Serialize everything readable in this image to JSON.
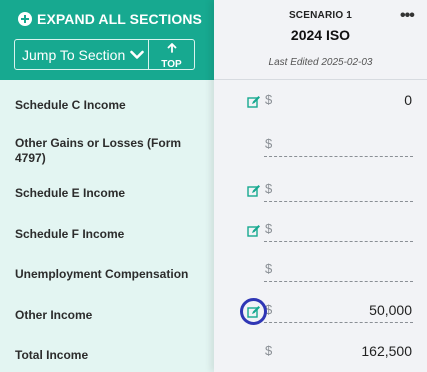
{
  "header": {
    "expand_all_label": "EXPAND ALL SECTIONS",
    "jump_to_label": "Jump To Section",
    "top_label": "TOP"
  },
  "scenario": {
    "label": "SCENARIO 1",
    "name": "2024 ISO",
    "last_edited": "Last Edited 2025-02-03",
    "more_label": "•••"
  },
  "currency_symbol": "$",
  "rows": [
    {
      "label": "Schedule C Income",
      "value": "0"
    },
    {
      "label": "Other Gains or Losses (Form 4797)",
      "value": ""
    },
    {
      "label": "Schedule E Income",
      "value": ""
    },
    {
      "label": "Schedule F Income",
      "value": ""
    },
    {
      "label": "Unemployment Compensation",
      "value": ""
    },
    {
      "label": "Other Income",
      "value": "50,000"
    },
    {
      "label": "Total Income",
      "value": "162,500"
    }
  ],
  "colors": {
    "teal": "#17a990",
    "focus_ring": "#2f36b5"
  }
}
